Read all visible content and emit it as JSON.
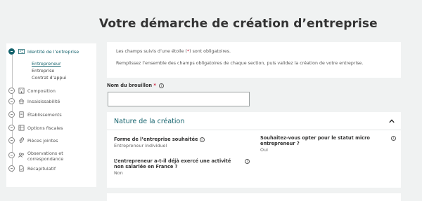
{
  "page": {
    "title": "Votre démarche de création d’entreprise"
  },
  "sidebar": {
    "steps": [
      {
        "label": "Identité de l’entreprise",
        "icon": "id-card-icon",
        "active": true
      },
      {
        "label": "Composition",
        "icon": "building-icon"
      },
      {
        "label": "Insaisissabilité",
        "icon": "home-icon"
      },
      {
        "label": "Établissements",
        "icon": "building-icon"
      },
      {
        "label": "Options fiscales",
        "icon": "table-icon"
      },
      {
        "label": "Pièces jointes",
        "icon": "paperclip-icon"
      },
      {
        "label": "Observations et correspondance",
        "icon": "users-icon"
      },
      {
        "label": "Récapitulatif",
        "icon": "document-icon"
      }
    ],
    "substeps": [
      {
        "label": "Entrepreneur",
        "current": true
      },
      {
        "label": "Entreprise"
      },
      {
        "label": "Contrat d’appui"
      }
    ]
  },
  "info": {
    "line1_before": "Les champs suivis d’une étoile (",
    "line1_star": "*",
    "line1_after": ") sont obligatoires.",
    "line2": "Remplissez l’ensemble des champs obligatoires de chaque section, puis validez la création de votre entreprise."
  },
  "draft": {
    "label": "Nom du brouillon",
    "required_mark": "*",
    "value": ""
  },
  "nature": {
    "title": "Nature de la création",
    "fields": [
      {
        "label": "Forme de l’entreprise souhaitée",
        "value": "Entrepreneur individuel"
      },
      {
        "label": "Souhaitez-vous opter pour le statut micro entrepreneur ?",
        "value": "Oui"
      },
      {
        "label": "L’entrepreneur a-t-il déjà exercé une activité non salariée en France ?",
        "value": "Non"
      }
    ]
  },
  "icons": {
    "info": "i",
    "collapse": "chevron-up-icon"
  },
  "colors": {
    "accent": "#15636d",
    "required": "#c8102e",
    "background": "#f0f2f2"
  }
}
